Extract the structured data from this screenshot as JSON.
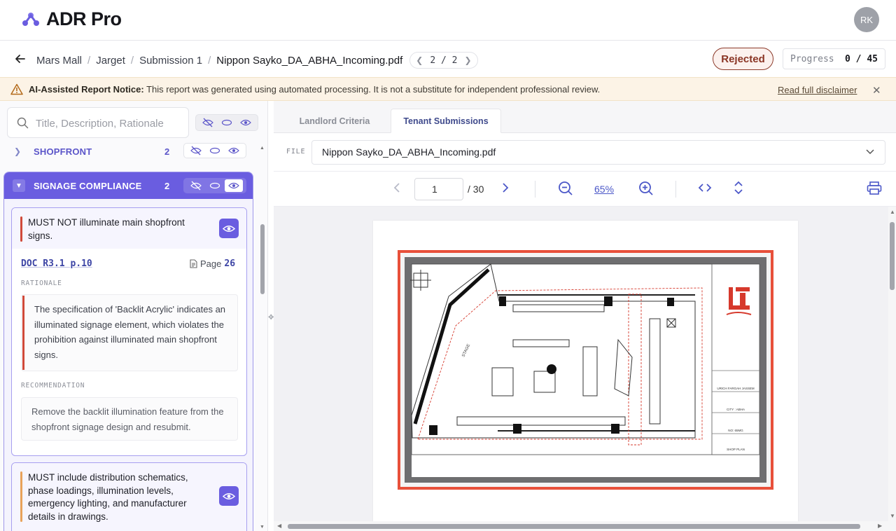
{
  "app": {
    "name": "ADR Pro",
    "avatar_initials": "RK"
  },
  "breadcrumb": {
    "items": [
      "Mars Mall",
      "Jarget",
      "Submission 1"
    ],
    "current": "Nippon Sayko_DA_ABHA_Incoming.pdf",
    "pager": "2 / 2"
  },
  "status": {
    "label": "Rejected"
  },
  "progress": {
    "label": "Progress",
    "value": "0 / 45"
  },
  "notice": {
    "title": "AI-Assisted Report Notice:",
    "text": " This report was generated using automated processing. It is not a substitute for independent professional review.",
    "link": "Read full disclaimer"
  },
  "search": {
    "placeholder": "Title, Description, Rationale"
  },
  "sections": [
    {
      "name": "SHOPFRONT",
      "count": "2"
    },
    {
      "name": "SIGNAGE COMPLIANCE",
      "count": "2"
    }
  ],
  "cards": [
    {
      "requirement": "MUST NOT illuminate main shopfront signs.",
      "doc_ref": "DOC R3.1 p.10",
      "page_label": "Page",
      "page_num": "26",
      "rationale_label": "RATIONALE",
      "rationale": "The specification of 'Backlit Acrylic' indicates an illuminated signage element, which violates the prohibition against illuminated main shopfront signs.",
      "recommendation_label": "RECOMMENDATION",
      "recommendation": "Remove the backlit illumination feature from the shopfront signage design and resubmit."
    },
    {
      "requirement": "MUST include distribution schematics, phase loadings, illumination levels, emergency lighting, and manufacturer details in drawings."
    }
  ],
  "tabs": [
    "Landlord Criteria",
    "Tenant Submissions"
  ],
  "file": {
    "label": "FILE",
    "value": "Nippon Sayko_DA_ABHA_Incoming.pdf"
  },
  "viewer": {
    "page": "1",
    "total": "/ 30",
    "zoom": "65%"
  },
  "drawing": {
    "title_block": [
      "URICH FARGAH JASSEM",
      "CITY : ABHA",
      "NO: 65MG",
      "SHOP PLAN"
    ],
    "stage_label": "STAGE"
  },
  "colors": {
    "accent": "#6a5de0",
    "rejected": "#8a3424",
    "violation": "#d04a3a",
    "warning_bg": "#fcf3e6"
  }
}
